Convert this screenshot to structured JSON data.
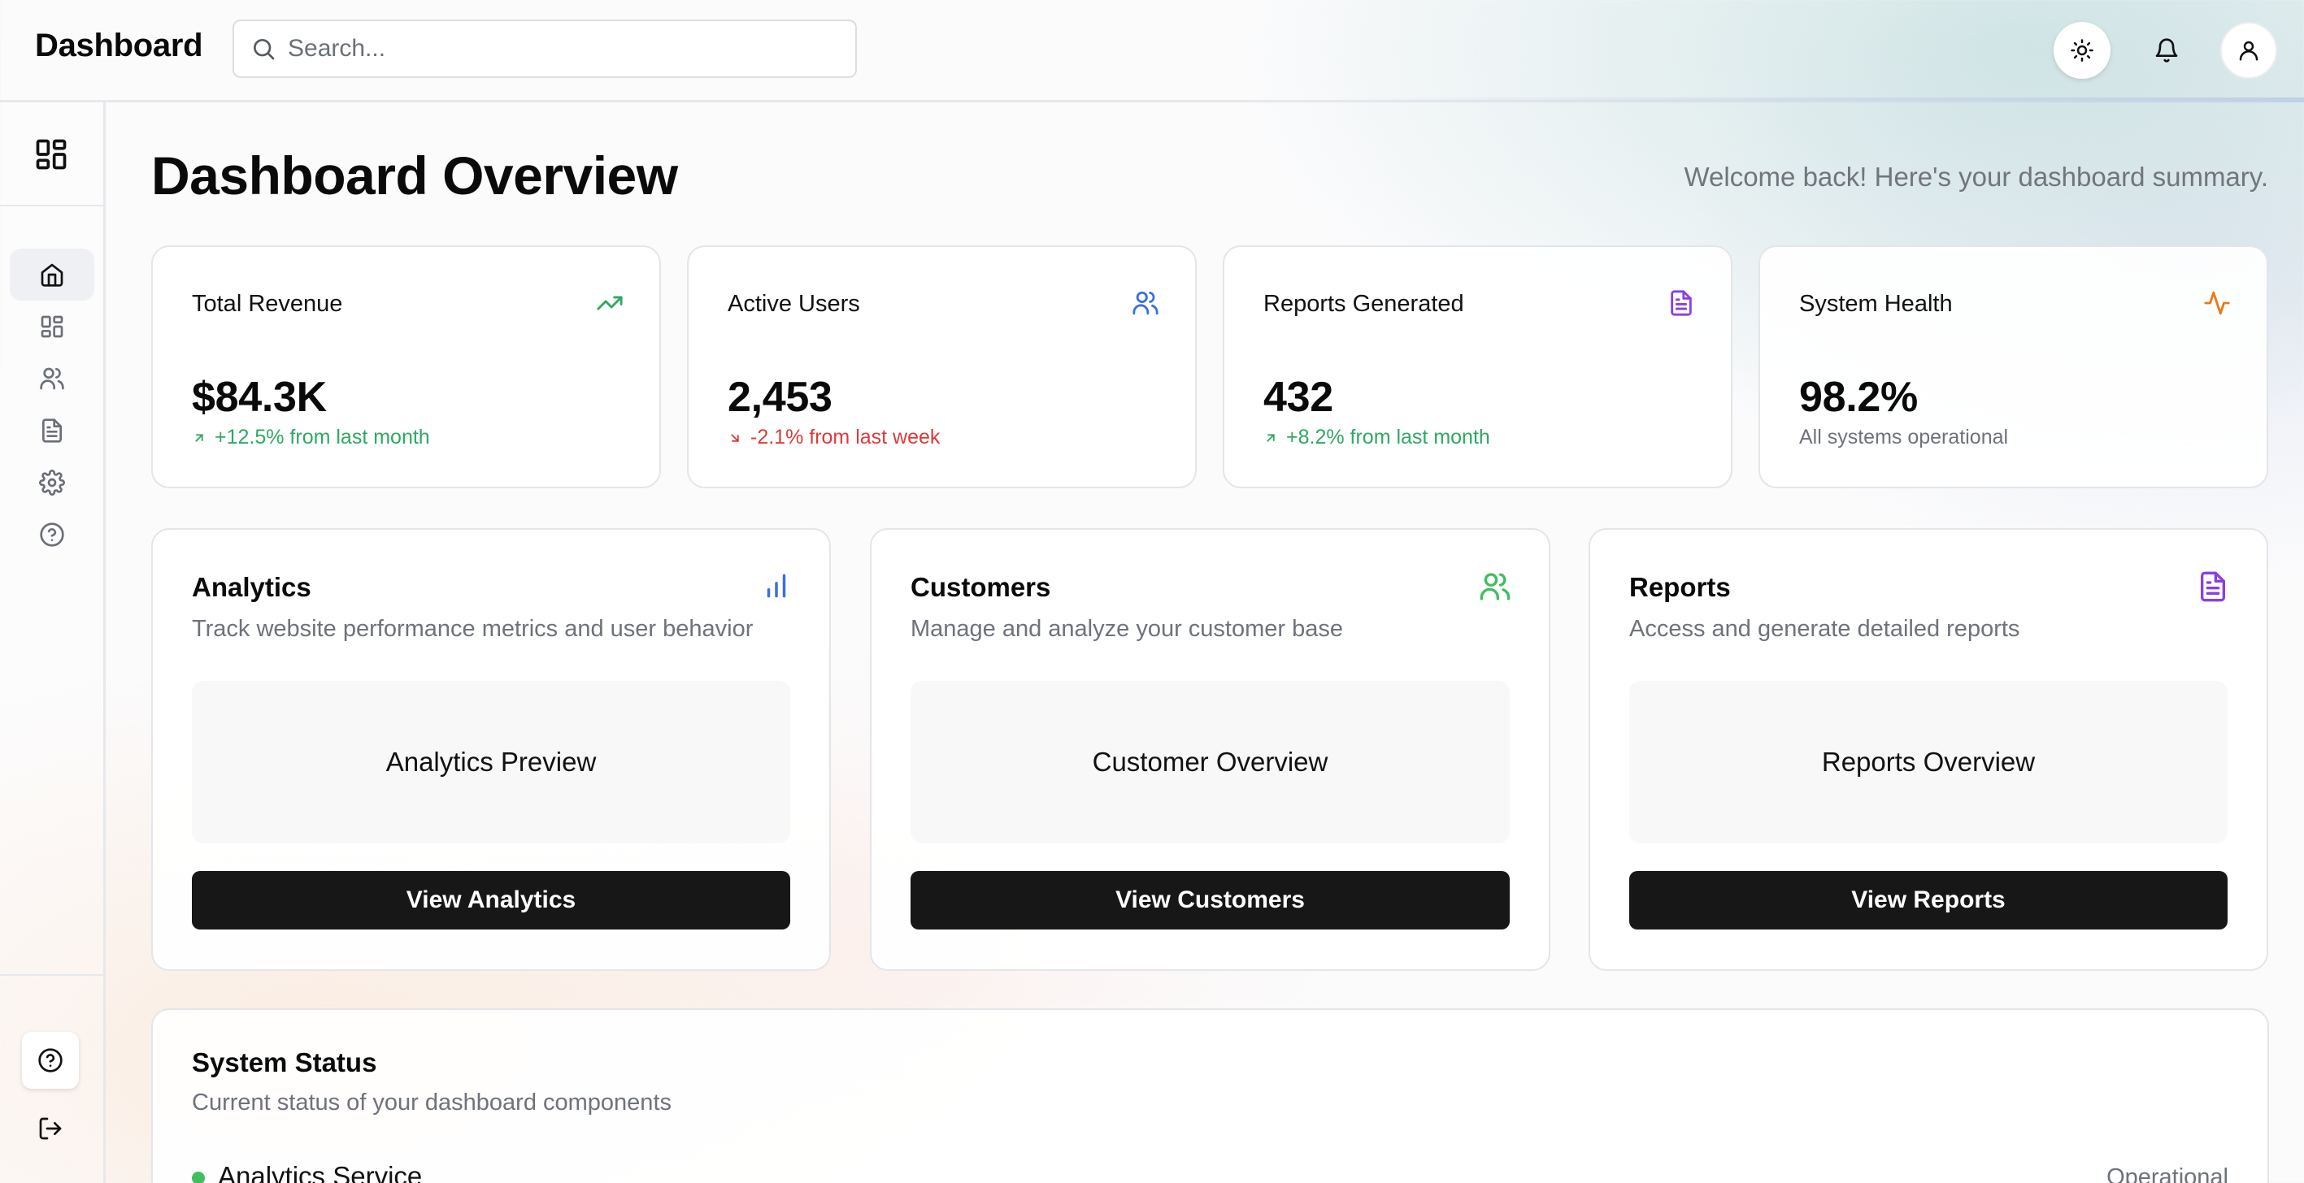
{
  "header": {
    "brand": "Dashboard",
    "search_placeholder": "Search..."
  },
  "page": {
    "title": "Dashboard Overview",
    "welcome": "Welcome back! Here's your dashboard summary."
  },
  "stats": [
    {
      "label": "Total Revenue",
      "value": "$84.3K",
      "delta": "+12.5% from last month",
      "trend": "up",
      "icon": "trending-up-icon",
      "color": "#2fa864"
    },
    {
      "label": "Active Users",
      "value": "2,453",
      "delta": "-2.1% from last week",
      "trend": "down",
      "icon": "users-icon",
      "color": "#3b6fe0"
    },
    {
      "label": "Reports Generated",
      "value": "432",
      "delta": "+8.2% from last month",
      "trend": "up",
      "icon": "file-text-icon",
      "color": "#8b3fe0"
    },
    {
      "label": "System Health",
      "value": "98.2%",
      "delta": "All systems operational",
      "trend": "neutral",
      "icon": "activity-icon",
      "color": "#ea7a17"
    }
  ],
  "features": [
    {
      "title": "Analytics",
      "description": "Track website performance metrics and user behavior",
      "preview": "Analytics Preview",
      "button": "View Analytics",
      "icon": "bar-chart-icon",
      "color": "#3b6fe0"
    },
    {
      "title": "Customers",
      "description": "Manage and analyze your customer base",
      "preview": "Customer Overview",
      "button": "View Customers",
      "icon": "users-icon",
      "color": "#3fbf5f"
    },
    {
      "title": "Reports",
      "description": "Access and generate detailed reports",
      "preview": "Reports Overview",
      "button": "View Reports",
      "icon": "file-text-icon",
      "color": "#8b3fe0"
    }
  ],
  "status": {
    "title": "System Status",
    "subtitle": "Current status of your dashboard components",
    "services": [
      {
        "name": "Analytics Service",
        "state": "Operational",
        "color": "#3fbf5f"
      }
    ]
  },
  "sidebar": {
    "items": [
      {
        "name": "home",
        "icon": "home-icon",
        "active": true
      },
      {
        "name": "dashboard",
        "icon": "layout-grid-icon",
        "active": false
      },
      {
        "name": "users",
        "icon": "users-icon",
        "active": false
      },
      {
        "name": "documents",
        "icon": "file-text-icon",
        "active": false
      },
      {
        "name": "settings",
        "icon": "gear-icon",
        "active": false
      },
      {
        "name": "help",
        "icon": "help-circle-icon",
        "active": false
      }
    ]
  }
}
